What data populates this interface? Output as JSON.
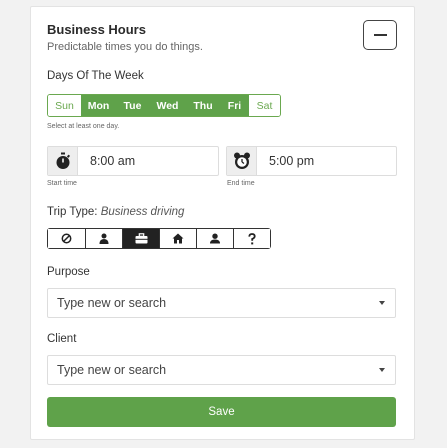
{
  "header": {
    "title": "Business Hours",
    "subtitle": "Predictable times you do things.",
    "collapse_icon": "minus-icon"
  },
  "days_section": {
    "label": "Days Of The Week",
    "hint": "Select at least one day.",
    "days": [
      {
        "label": "Sun",
        "selected": false
      },
      {
        "label": "Mon",
        "selected": true
      },
      {
        "label": "Tue",
        "selected": true
      },
      {
        "label": "Wed",
        "selected": true
      },
      {
        "label": "Thu",
        "selected": true
      },
      {
        "label": "Fri",
        "selected": true
      },
      {
        "label": "Sat",
        "selected": false
      }
    ]
  },
  "start_time": {
    "value": "8:00 am",
    "caption": "Start time",
    "icon": "stopwatch-icon"
  },
  "end_time": {
    "value": "5:00 pm",
    "caption": "End time",
    "icon": "alarm-clock-icon"
  },
  "trip_type": {
    "label": "Trip Type:",
    "value": "Business driving",
    "options": [
      {
        "icon": "block-icon",
        "active": false
      },
      {
        "icon": "person-icon",
        "active": false
      },
      {
        "icon": "briefcase-icon",
        "active": true
      },
      {
        "icon": "home-icon",
        "active": false
      },
      {
        "icon": "commute-icon",
        "active": false
      },
      {
        "icon": "question-icon",
        "active": false
      }
    ]
  },
  "purpose": {
    "label": "Purpose",
    "placeholder": "Type new or search"
  },
  "client": {
    "label": "Client",
    "placeholder": "Type new or search"
  },
  "save_label": "Save",
  "colors": {
    "accent": "#5fa24a",
    "accent_border": "#6aa84f"
  }
}
